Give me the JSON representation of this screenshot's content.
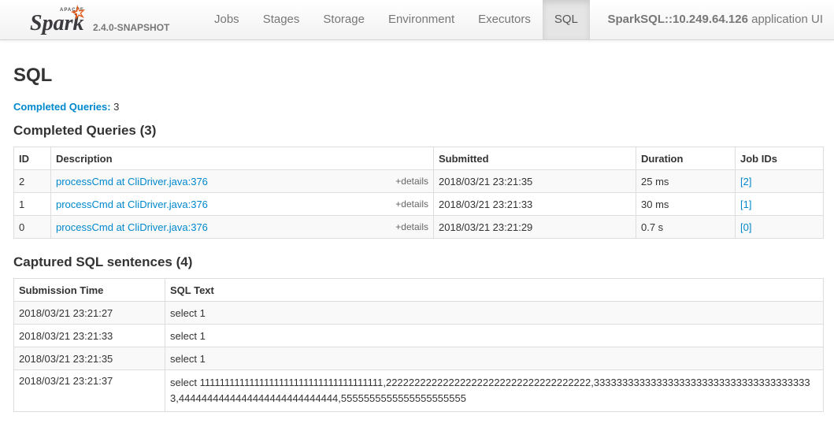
{
  "navbar": {
    "brand_name": "Spark",
    "brand_prefix": "APACHE",
    "version": "2.4.0-SNAPSHOT",
    "tabs": [
      {
        "label": "Jobs",
        "active": false
      },
      {
        "label": "Stages",
        "active": false
      },
      {
        "label": "Storage",
        "active": false
      },
      {
        "label": "Environment",
        "active": false
      },
      {
        "label": "Executors",
        "active": false
      },
      {
        "label": "SQL",
        "active": true
      }
    ],
    "app_name_bold": "SparkSQL::10.249.64.126",
    "app_name_suffix": " application UI"
  },
  "page": {
    "title": "SQL",
    "summary_label": "Completed Queries:",
    "summary_value": "3"
  },
  "completed_queries": {
    "heading": "Completed Queries (3)",
    "columns": [
      "ID",
      "Description",
      "Submitted",
      "Duration",
      "Job IDs"
    ],
    "details_label": "+details",
    "rows": [
      {
        "id": "2",
        "description": "processCmd at CliDriver.java:376",
        "submitted": "2018/03/21 23:21:35",
        "duration": "25 ms",
        "job_ids": "[2]"
      },
      {
        "id": "1",
        "description": "processCmd at CliDriver.java:376",
        "submitted": "2018/03/21 23:21:33",
        "duration": "30 ms",
        "job_ids": "[1]"
      },
      {
        "id": "0",
        "description": "processCmd at CliDriver.java:376",
        "submitted": "2018/03/21 23:21:29",
        "duration": "0.7 s",
        "job_ids": "[0]"
      }
    ]
  },
  "captured_sql": {
    "heading": "Captured SQL sentences (4)",
    "columns": [
      "Submission Time",
      "SQL Text"
    ],
    "rows": [
      {
        "time": "2018/03/21 23:21:27",
        "text": "select 1"
      },
      {
        "time": "2018/03/21 23:21:33",
        "text": "select 1"
      },
      {
        "time": "2018/03/21 23:21:35",
        "text": "select 1"
      },
      {
        "time": "2018/03/21 23:21:37",
        "text": "select 1111111111111111111111111111111111111,222222222222222222222222222222222222,333333333333333333333333333333333333333,4444444444444444444444444444,5555555555555555555555"
      }
    ]
  },
  "colors": {
    "link": "#0088cc",
    "spark_orange": "#e25a1c",
    "navbar_text": "#777777"
  }
}
